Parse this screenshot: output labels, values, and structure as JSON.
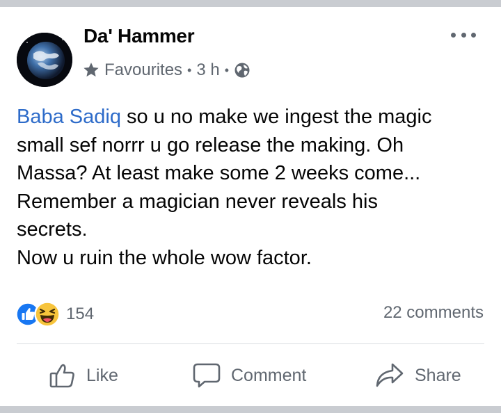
{
  "post": {
    "author": "Da' Hammer",
    "audience": "Favourites",
    "time": "3 h",
    "separator": "•",
    "text_mention": "Baba Sadiq",
    "text_line1": " so u no make we ingest the magic",
    "text_line2": "small sef norrr u go release the making. Oh",
    "text_line3": "Massa? At least make some 2 weeks come...",
    "text_line4": "Remember a magician never reveals his",
    "text_line5": "secrets.",
    "text_line6": "Now u ruin the whole wow factor."
  },
  "engagement": {
    "reaction_count": "154",
    "comments_label": "22 comments",
    "reactions": [
      "like-reaction-icon",
      "haha-reaction-icon"
    ]
  },
  "actions": {
    "like": "Like",
    "comment": "Comment",
    "share": "Share"
  },
  "colors": {
    "mention": "#2d6bc9",
    "secondary_text": "#606770",
    "like_blue": "#1877f2",
    "haha_yellow": "#f7c43c",
    "background": "#c9ccd1"
  },
  "icons": {
    "audience": "star-icon",
    "privacy": "globe-icon",
    "menu": "more-options-icon"
  }
}
